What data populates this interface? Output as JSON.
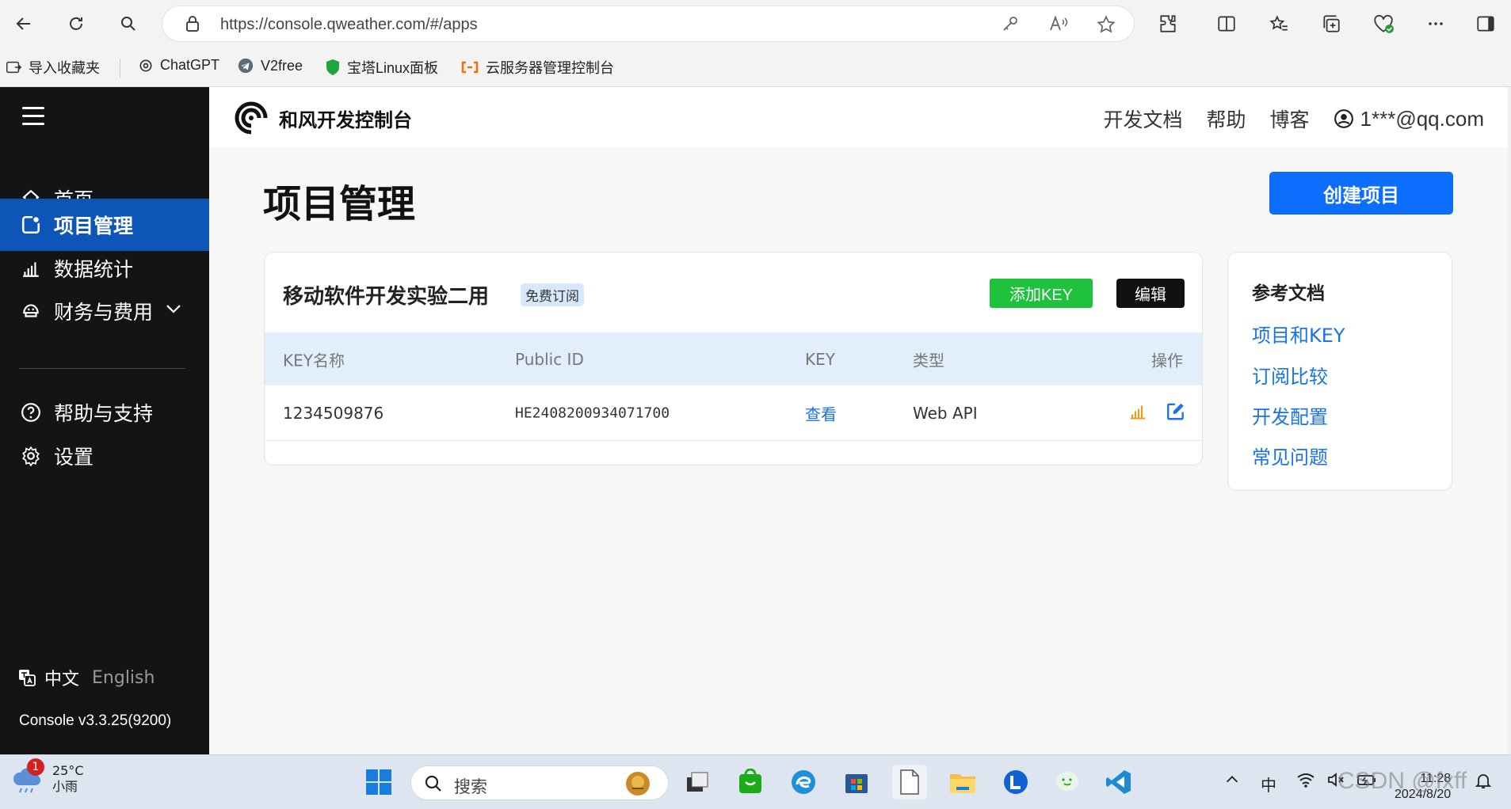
{
  "browser": {
    "url": "https://console.qweather.com/#/apps",
    "bookmarks": [
      {
        "label": "导入收藏夹"
      },
      {
        "label": "ChatGPT"
      },
      {
        "label": "V2free"
      },
      {
        "label": "宝塔Linux面板"
      },
      {
        "label": "云服务器管理控制台"
      }
    ]
  },
  "header": {
    "brand": "和风开发控制台",
    "links": [
      "开发文档",
      "帮助",
      "博客"
    ],
    "user": "1***@qq.com"
  },
  "sidebar": {
    "items": [
      {
        "label": "首页",
        "icon": "home-icon"
      },
      {
        "label": "项目管理",
        "icon": "project-icon",
        "active": true
      },
      {
        "label": "数据统计",
        "icon": "chart-icon"
      },
      {
        "label": "财务与费用",
        "icon": "wallet-icon"
      },
      {
        "label": "帮助与支持",
        "icon": "help-icon"
      },
      {
        "label": "设置",
        "icon": "gear-icon"
      }
    ],
    "lang_zh": "中文",
    "lang_en": "English",
    "version": "Console v3.3.25(9200)"
  },
  "main": {
    "title": "项目管理",
    "create_button": "创建项目",
    "project": {
      "name": "移动软件开发实验二用",
      "badge": "免费订阅",
      "add_key_button": "添加KEY",
      "edit_button": "编辑",
      "columns": [
        "KEY名称",
        "Public ID",
        "KEY",
        "类型",
        "操作"
      ],
      "rows": [
        {
          "key_name": "1234509876",
          "public_id": "HE2408200934071700",
          "key": "查看",
          "type": "Web API"
        }
      ]
    },
    "reference": {
      "title": "参考文档",
      "links": [
        "项目和KEY",
        "订阅比较",
        "开发配置",
        "常见问题"
      ]
    }
  },
  "taskbar": {
    "weather_temp": "25°C",
    "weather_desc": "小雨",
    "notification_count": "1",
    "search_placeholder": "搜索",
    "ime": "中",
    "time": "11:28",
    "date": "2024/8/20",
    "watermark": "CSDN @fxff"
  },
  "colors": {
    "sidebar_bg": "#141414",
    "active_nav": "#0d55b7",
    "primary": "#0d6efd",
    "add_key_green": "#1ec23d",
    "link_blue": "#1a73e8",
    "table_header_bg": "#e2eefc"
  }
}
